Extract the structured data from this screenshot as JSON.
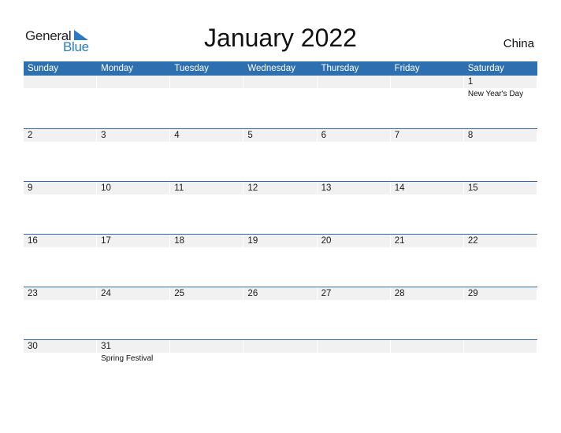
{
  "logo": {
    "line1": "General",
    "line2": "Blue",
    "icon": "triangle-flag-icon"
  },
  "title": "January 2022",
  "country": "China",
  "colors": {
    "accent": "#2e6fb0",
    "cell_bg": "#f1f1f1",
    "logo_blue": "#2a7bc4"
  },
  "weekdays": [
    "Sunday",
    "Monday",
    "Tuesday",
    "Wednesday",
    "Thursday",
    "Friday",
    "Saturday"
  ],
  "weeks": [
    [
      {
        "day": ""
      },
      {
        "day": ""
      },
      {
        "day": ""
      },
      {
        "day": ""
      },
      {
        "day": ""
      },
      {
        "day": ""
      },
      {
        "day": "1",
        "holiday": "New Year's Day"
      }
    ],
    [
      {
        "day": "2"
      },
      {
        "day": "3"
      },
      {
        "day": "4"
      },
      {
        "day": "5"
      },
      {
        "day": "6"
      },
      {
        "day": "7"
      },
      {
        "day": "8"
      }
    ],
    [
      {
        "day": "9"
      },
      {
        "day": "10"
      },
      {
        "day": "11"
      },
      {
        "day": "12"
      },
      {
        "day": "13"
      },
      {
        "day": "14"
      },
      {
        "day": "15"
      }
    ],
    [
      {
        "day": "16"
      },
      {
        "day": "17"
      },
      {
        "day": "18"
      },
      {
        "day": "19"
      },
      {
        "day": "20"
      },
      {
        "day": "21"
      },
      {
        "day": "22"
      }
    ],
    [
      {
        "day": "23"
      },
      {
        "day": "24"
      },
      {
        "day": "25"
      },
      {
        "day": "26"
      },
      {
        "day": "27"
      },
      {
        "day": "28"
      },
      {
        "day": "29"
      }
    ],
    [
      {
        "day": "30"
      },
      {
        "day": "31",
        "holiday": "Spring Festival"
      },
      {
        "day": ""
      },
      {
        "day": ""
      },
      {
        "day": ""
      },
      {
        "day": ""
      },
      {
        "day": ""
      }
    ]
  ]
}
